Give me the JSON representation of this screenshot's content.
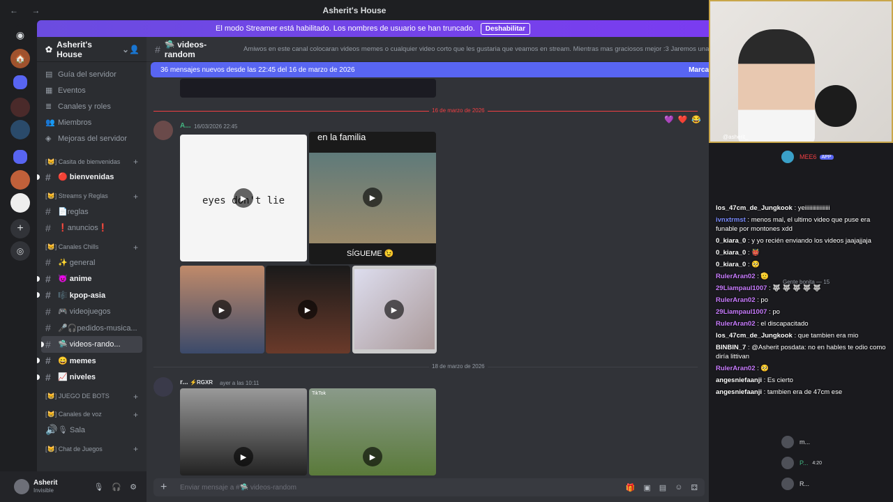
{
  "window": {
    "title": "Asherit's House",
    "nav": "← →"
  },
  "streamer_banner": {
    "text": "El modo Streamer está habilitado. Los nombres de usuario se han truncado.",
    "button": "Deshabilitar"
  },
  "server": {
    "name": "Asherit's House",
    "menu": [
      {
        "label": "Guía del servidor",
        "icon": "guide-icon",
        "glyph": "▤"
      },
      {
        "label": "Eventos",
        "icon": "calendar-icon",
        "glyph": "▦"
      },
      {
        "label": "Canales y roles",
        "icon": "channels-icon",
        "glyph": "≣"
      },
      {
        "label": "Miembros",
        "icon": "members-icon",
        "glyph": "👥"
      },
      {
        "label": "Mejoras del servidor",
        "icon": "boost-icon",
        "glyph": "◈"
      }
    ],
    "categories": [
      {
        "name": "[😸] Casita de bienvenidas",
        "channels": [
          {
            "label": "🔴 bienvenidas",
            "unread": true,
            "bullet": true
          }
        ]
      },
      {
        "name": "[😸] Streams y Reglas",
        "channels": [
          {
            "label": "📄reglas",
            "unread": false
          },
          {
            "label": "❗anuncios❗",
            "unread": false
          }
        ]
      },
      {
        "name": "[😸] Canales Chills",
        "channels": [
          {
            "label": "✨ general",
            "unread": false
          },
          {
            "label": "😈 anime",
            "unread": true,
            "bullet": true
          },
          {
            "label": "🎼 kpop-asia",
            "unread": true,
            "bullet": true
          },
          {
            "label": "🎮 videojuegos",
            "unread": false
          },
          {
            "label": "🎤🎧pedidos-musica...",
            "unread": false
          },
          {
            "label": "🛸 videos-rando...",
            "active": true,
            "bullet": true
          },
          {
            "label": "😄 memes",
            "unread": true,
            "bullet": true
          },
          {
            "label": "📈 niveles",
            "unread": true,
            "bullet": true
          }
        ]
      },
      {
        "name": "[😸] JUEGO DE BOTS",
        "channels": []
      },
      {
        "name": "[😸] Canales de voz",
        "channels": [
          {
            "label": "🎙 Sala",
            "unread": false,
            "voice": true
          }
        ]
      },
      {
        "name": "[😸] Chat de Juegos",
        "channels": []
      }
    ]
  },
  "user": {
    "name": "Asherit",
    "status": "Invisible"
  },
  "channel": {
    "name": "🛸 videos-random",
    "topic": "Amiwos en este canal colocaran videos memes o cualquier video corto que les gustaria que veamos en stream. Mientras mas graciosos mejor :3 Jaremos una recop...",
    "new_messages": "36 mensajes nuevos desde las 22:45 del 16 de marzo de 2026",
    "mark_read": "Marca"
  },
  "messages": [
    {
      "date": "16 de marzo de 2026",
      "author": "A...",
      "time": "16/03/2026 22:45",
      "caption_top": "en la familia",
      "caption_video": "eyes don't lie",
      "caption_follow": "SÍGUEME 😉",
      "reactions": [
        "💜",
        "❤️",
        "😂"
      ]
    },
    {
      "date": "18 de marzo de 2026",
      "author": "r...",
      "tag": "⚡RGXR",
      "time": "ayer a las 10:11",
      "caption": "TikTok"
    }
  ],
  "composer": {
    "placeholder": "Enviar mensaje a #🛸 videos-random"
  },
  "overlay": {
    "cam_name": "@asherit_",
    "chat": [
      {
        "nick": "los_47cm_de_Jungkook",
        "color": "#ffffff",
        "text": "yeiiiiiiiiiiiiiiiii"
      },
      {
        "nick": "ivnxtrmst",
        "color": "#7b8cff",
        "text": "menos mal, el ultimo video que puse era funable por montones xdd"
      },
      {
        "nick": "0_kiara_0",
        "color": "#ffffff",
        "text": "y yo recién enviando los videos jaajajjaja"
      },
      {
        "nick": "0_kiara_0",
        "color": "#ffffff",
        "text": "👹"
      },
      {
        "nick": "0_kiara_0",
        "color": "#ffffff",
        "text": "🥺"
      },
      {
        "nick": "RulerAran02",
        "color": "#c97cff",
        "text": "🫡"
      },
      {
        "nick": "29Liampaul1007",
        "color": "#c97cff",
        "text": "🐺 🐺 🐺 🐺 🐺"
      },
      {
        "nick": "RulerAran02",
        "color": "#c97cff",
        "text": "po"
      },
      {
        "nick": "29Liampaul1007",
        "color": "#c97cff",
        "text": "po"
      },
      {
        "nick": "RulerAran02",
        "color": "#c97cff",
        "text": "el discapacitado"
      },
      {
        "nick": "los_47cm_de_Jungkook",
        "color": "#ffffff",
        "text": "que tambien era mio"
      },
      {
        "nick": "BINBIN_7",
        "color": "#ffffff",
        "text": "@Asherit posdata: no en hables te odio como diría littivan"
      },
      {
        "nick": "RulerAran02",
        "color": "#c97cff",
        "text": "🥺"
      },
      {
        "nick": "angesniefaanji",
        "color": "#ffffff",
        "text": "Es cierto"
      },
      {
        "nick": "angesniefaanji",
        "color": "#ffffff",
        "text": "tambien era de 47cm ese"
      }
    ],
    "members": [
      {
        "name": "MEE6",
        "badge": "APP"
      },
      {
        "name": "Gente bonita — 15",
        "badge": ""
      },
      {
        "name": "m...",
        "badge": ""
      },
      {
        "name": "P...",
        "badge": "4:20"
      },
      {
        "name": "R...",
        "badge": ""
      }
    ]
  }
}
